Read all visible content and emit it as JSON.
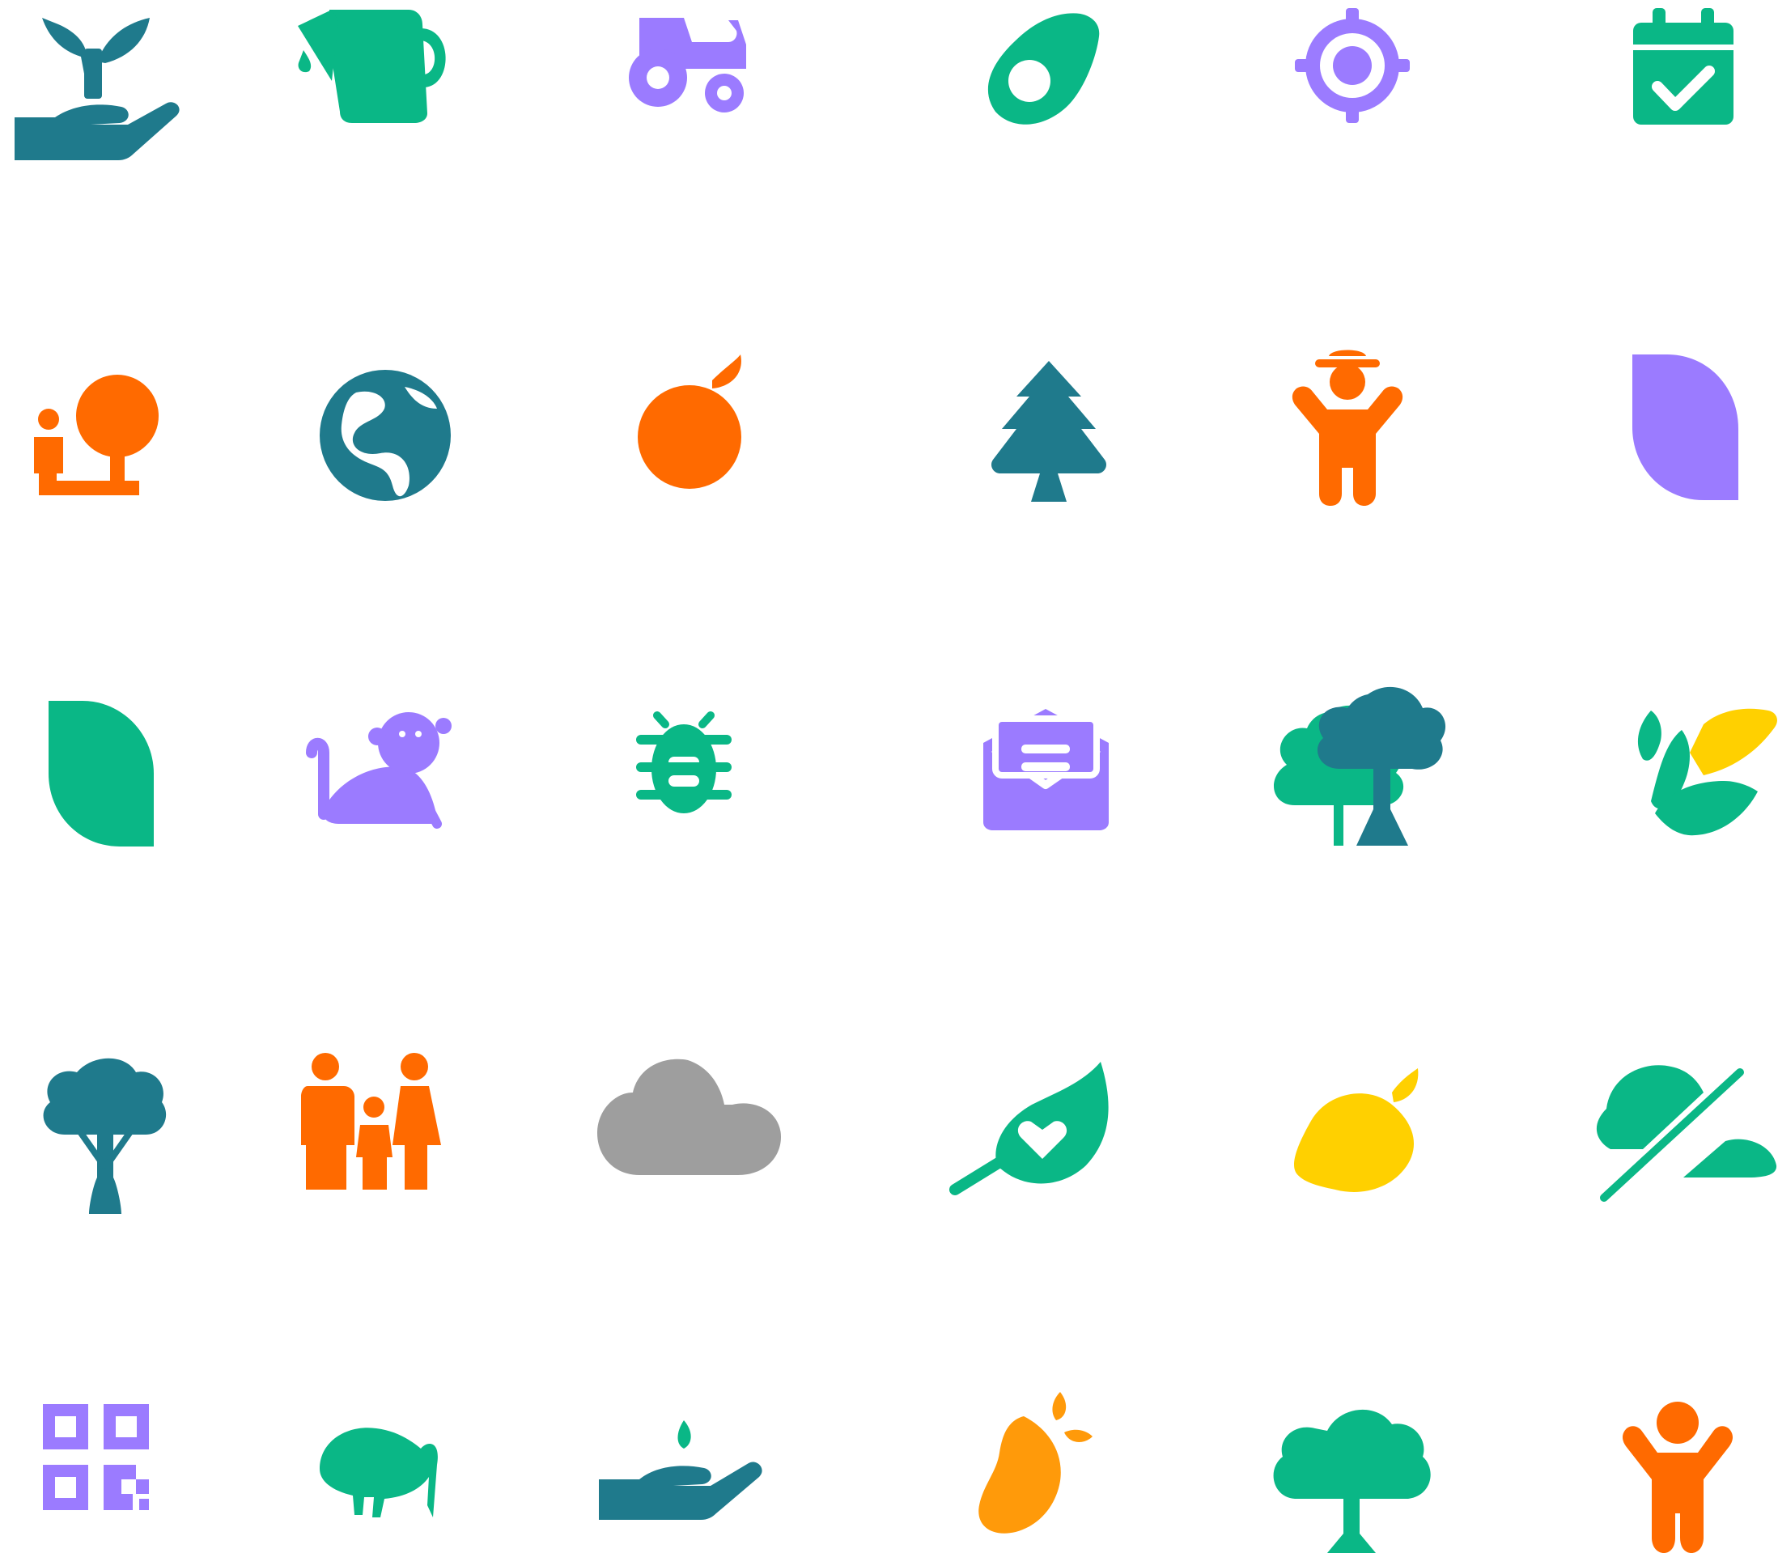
{
  "colors": {
    "teal": "#1f7a8c",
    "green": "#0ab786",
    "purple": "#9b7bff",
    "orange": "#ff6a00",
    "gray": "#9e9e9e",
    "yellow": "#ffd000",
    "amber": "#ff9a0a"
  },
  "icons": [
    {
      "name": "seedling-in-hand-icon",
      "color": "teal"
    },
    {
      "name": "watering-can-icon",
      "color": "green"
    },
    {
      "name": "tractor-icon",
      "color": "purple"
    },
    {
      "name": "avocado-icon",
      "color": "green"
    },
    {
      "name": "crosshair-icon",
      "color": "purple"
    },
    {
      "name": "calendar-check-icon",
      "color": "green"
    },
    {
      "name": "person-with-tree-icon",
      "color": "orange"
    },
    {
      "name": "globe-icon",
      "color": "teal"
    },
    {
      "name": "orange-fruit-icon",
      "color": "orange"
    },
    {
      "name": "pine-tree-icon",
      "color": "teal"
    },
    {
      "name": "farmer-icon",
      "color": "orange"
    },
    {
      "name": "leaf-purple-icon",
      "color": "purple"
    },
    {
      "name": "leaf-green-icon",
      "color": "green"
    },
    {
      "name": "monkey-icon",
      "color": "purple"
    },
    {
      "name": "bug-icon",
      "color": "green"
    },
    {
      "name": "envelope-open-text-icon",
      "color": "purple"
    },
    {
      "name": "trees-icon",
      "color": "green"
    },
    {
      "name": "corn-icon",
      "color": "green"
    },
    {
      "name": "tree-icon",
      "color": "teal"
    },
    {
      "name": "family-icon",
      "color": "orange"
    },
    {
      "name": "cloud-icon",
      "color": "gray"
    },
    {
      "name": "leaf-heart-icon",
      "color": "green"
    },
    {
      "name": "lemon-icon",
      "color": "yellow"
    },
    {
      "name": "cloud-slash-icon",
      "color": "green"
    },
    {
      "name": "qrcode-icon",
      "color": "purple"
    },
    {
      "name": "kiwi-bird-icon",
      "color": "green"
    },
    {
      "name": "hand-holding-seed-icon",
      "color": "teal"
    },
    {
      "name": "mango-icon",
      "color": "amber"
    },
    {
      "name": "round-tree-icon",
      "color": "green"
    },
    {
      "name": "child-arms-up-icon",
      "color": "orange"
    }
  ]
}
